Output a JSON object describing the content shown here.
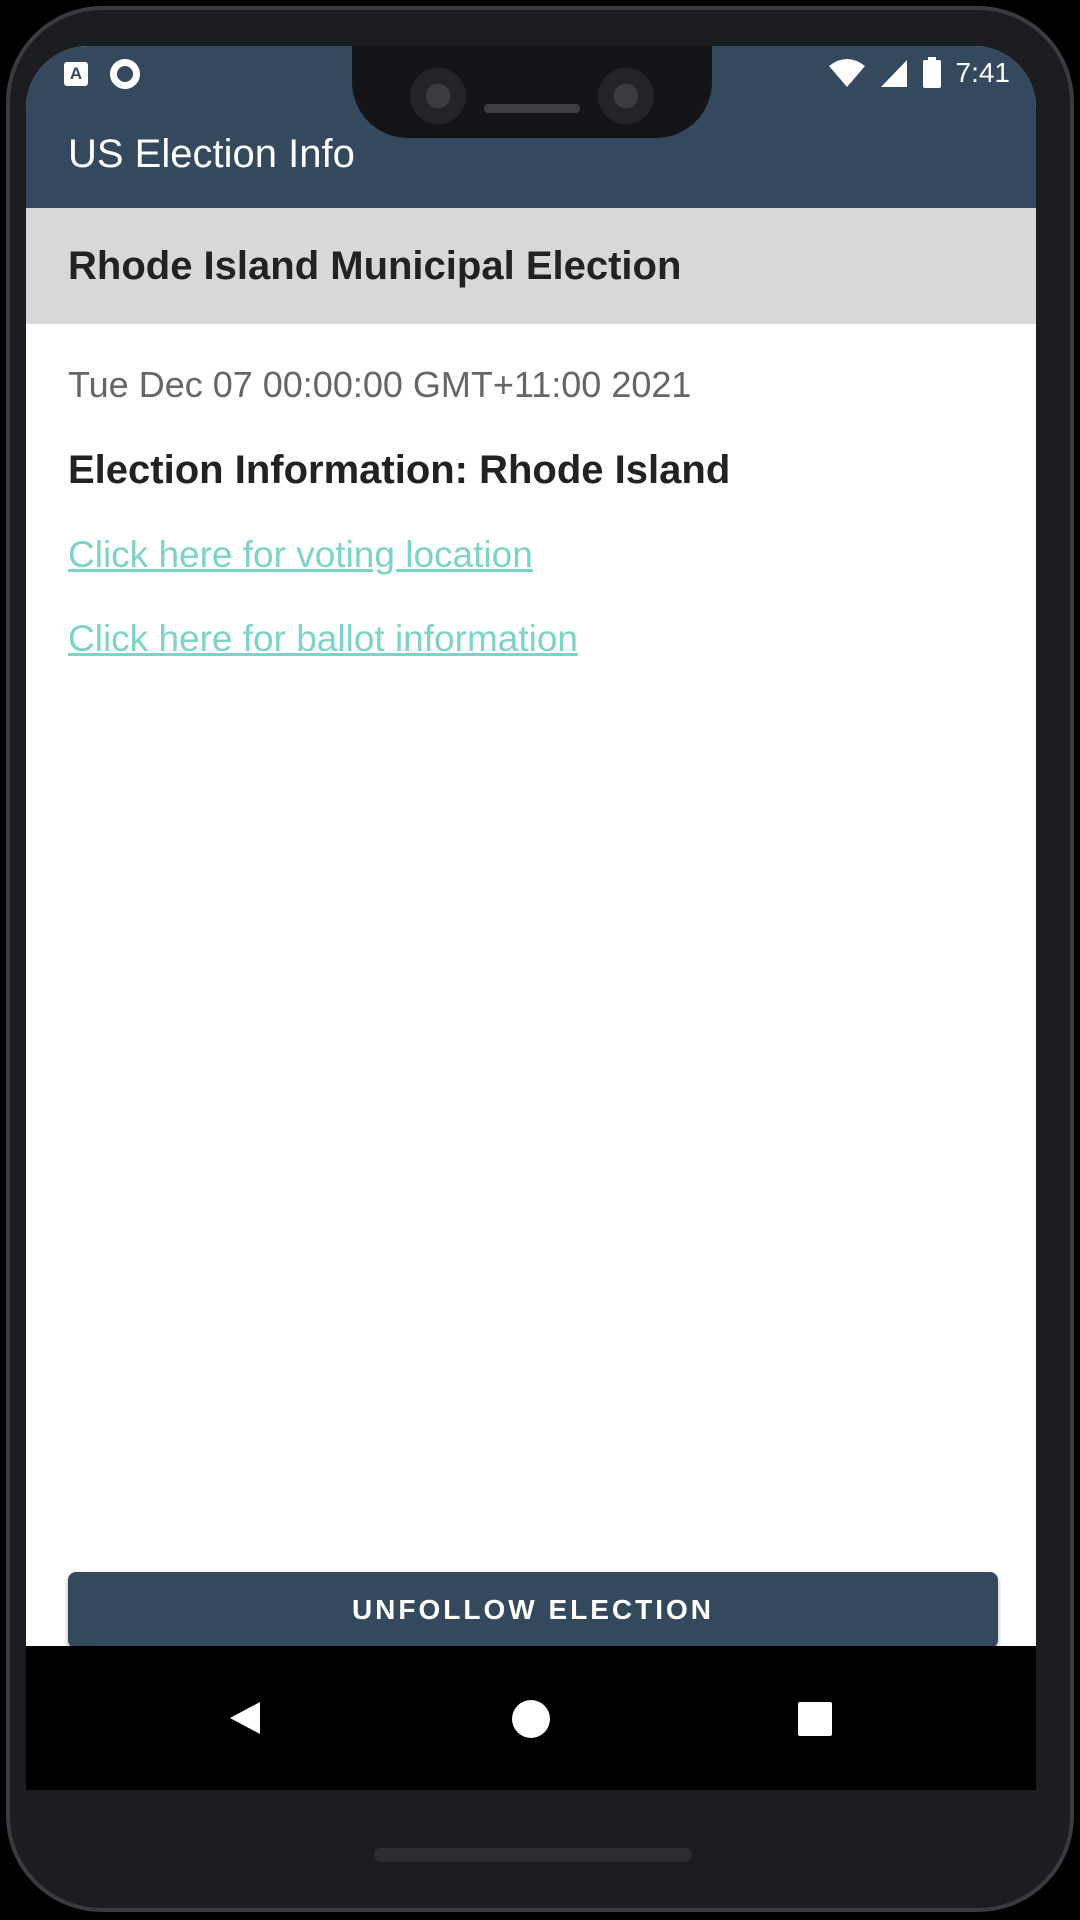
{
  "status_bar": {
    "left_icons": [
      "a-notification-icon",
      "circle-notification-icon"
    ],
    "left_letter": "A",
    "right_icons": [
      "wifi-icon",
      "signal-icon",
      "battery-icon"
    ],
    "time": "7:41"
  },
  "app_bar": {
    "title": "US Election Info"
  },
  "election": {
    "name": "Rhode Island Municipal Election",
    "date": "Tue Dec 07 00:00:00 GMT+11:00 2021",
    "info_title": "Election Information: Rhode Island",
    "voting_location_link": "Click here for voting location",
    "ballot_info_link": "Click here for ballot information"
  },
  "actions": {
    "unfollow_label": "UNFOLLOW ELECTION"
  },
  "nav_bar": {
    "icons": [
      "back-icon",
      "home-icon",
      "recents-icon"
    ]
  },
  "colors": {
    "primary": "#34495e",
    "link": "#7dd3c8",
    "subheader_bg": "#d8d8d8"
  }
}
